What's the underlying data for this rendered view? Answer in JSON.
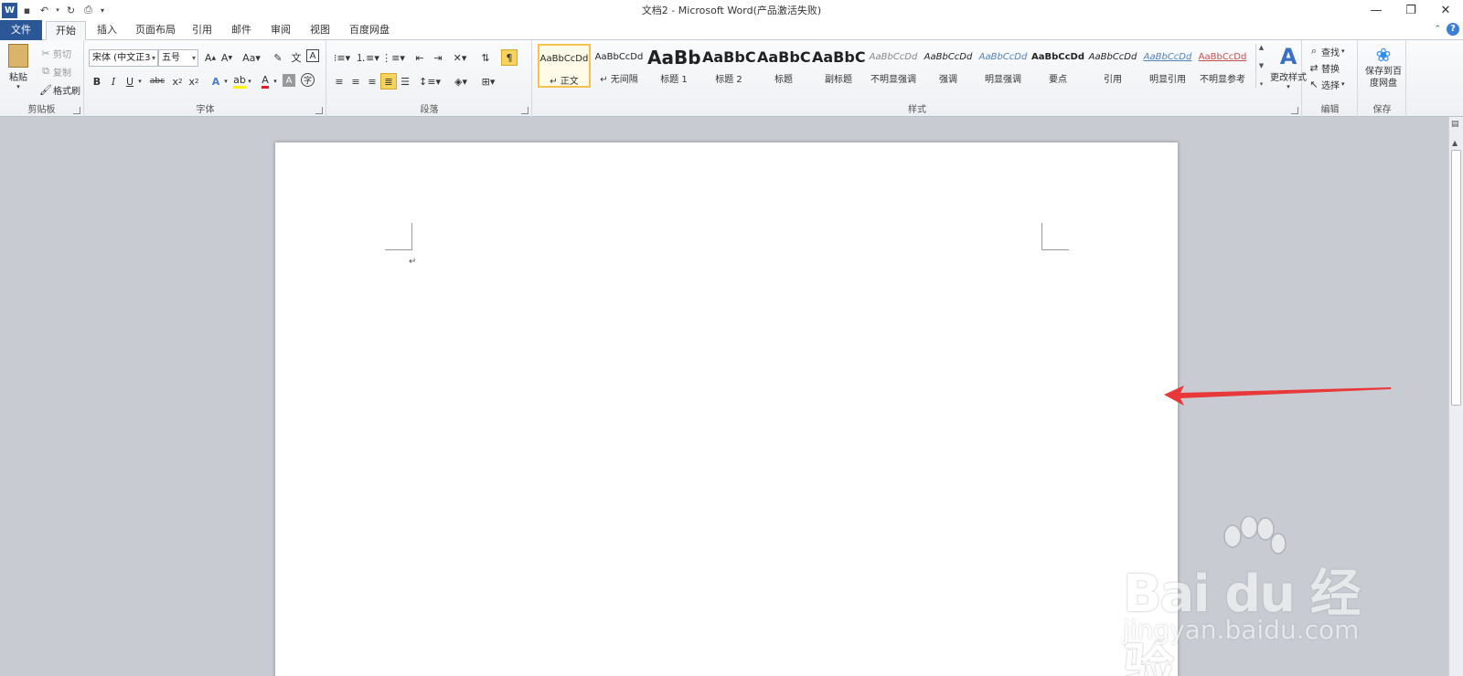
{
  "window": {
    "title": "文档2 - Microsoft Word(产品激活失败)",
    "controls": [
      "—",
      "❐",
      "✕"
    ]
  },
  "qat": {
    "app_icon": "W"
  },
  "tabs": [
    "文件",
    "开始",
    "插入",
    "页面布局",
    "引用",
    "邮件",
    "审阅",
    "视图",
    "百度网盘"
  ],
  "clipboard": {
    "group_label": "剪贴板",
    "paste": "粘贴",
    "cut": "剪切",
    "copy": "复制",
    "format_painter": "格式刷"
  },
  "font": {
    "group_label": "字体",
    "font_name": "宋体 (中文正3",
    "font_size": "五号"
  },
  "paragraph": {
    "group_label": "段落"
  },
  "styles": {
    "group_label": "样式",
    "items": [
      {
        "sample": "AaBbCcDd",
        "name": "↵ 正文"
      },
      {
        "sample": "AaBbCcDd",
        "name": "↵ 无间隔"
      },
      {
        "sample": "AaBb",
        "name": "标题 1"
      },
      {
        "sample": "AaBbC",
        "name": "标题 2"
      },
      {
        "sample": "AaBbC",
        "name": "标题"
      },
      {
        "sample": "AaBbC",
        "name": "副标题"
      },
      {
        "sample": "AaBbCcDd",
        "name": "不明显强调"
      },
      {
        "sample": "AaBbCcDd",
        "name": "强调"
      },
      {
        "sample": "AaBbCcDd",
        "name": "明显强调"
      },
      {
        "sample": "AaBbCcDd",
        "name": "要点"
      },
      {
        "sample": "AaBbCcDd",
        "name": "引用"
      },
      {
        "sample": "AaBbCcDd",
        "name": "明显引用"
      },
      {
        "sample": "AaBbCcDd",
        "name": "不明显参考"
      }
    ],
    "change_styles": "更改样式"
  },
  "editing": {
    "group_label": "编辑",
    "find": "查找",
    "replace": "替换",
    "select": "选择"
  },
  "save_group": {
    "group_label": "保存",
    "button": "保存到百度网盘"
  },
  "document": {
    "paragraph_mark": "↵"
  },
  "watermark": {
    "logo": "Bai du 经验",
    "url": "jingyan.baidu.com"
  },
  "colors": {
    "file_tab": "#2b5797",
    "arrow": "#e8383a",
    "selected_style_border": "#f2c150"
  }
}
